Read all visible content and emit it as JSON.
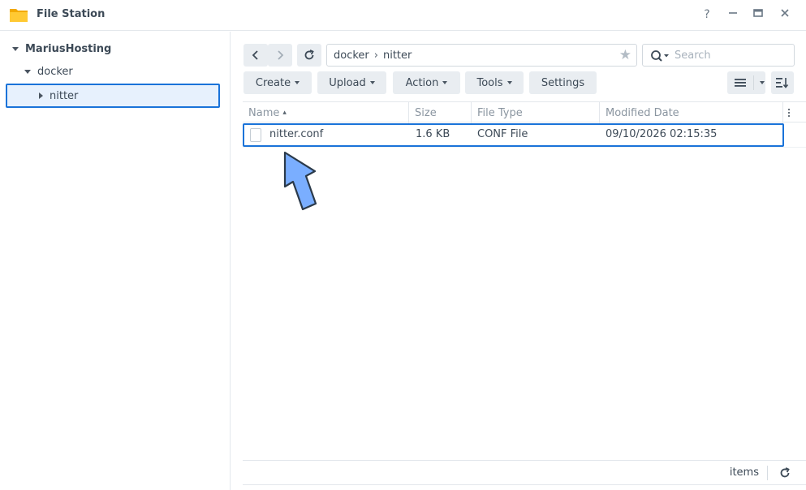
{
  "window": {
    "title": "File Station",
    "controls": {
      "help": "?",
      "minimize": "—",
      "maximize": "□",
      "close": "✕"
    }
  },
  "sidebar": {
    "tree": [
      {
        "label": "MariusHosting",
        "expanded": true
      },
      {
        "label": "docker",
        "expanded": true
      },
      {
        "label": "nitter",
        "expanded": false,
        "selected": true
      }
    ]
  },
  "toolbar": {
    "path": [
      "docker",
      "nitter"
    ],
    "path_separator": "›",
    "search_placeholder": "Search",
    "buttons": {
      "create": "Create",
      "upload": "Upload",
      "action": "Action",
      "tools": "Tools",
      "settings": "Settings"
    }
  },
  "table": {
    "columns": [
      "Name",
      "Size",
      "File Type",
      "Modified Date"
    ],
    "sort_indicator": "▴",
    "rows": [
      {
        "name": "nitter.conf",
        "size": "1.6 KB",
        "type": "CONF File",
        "modified": "09/10/2026 02:15:35"
      }
    ]
  },
  "footer": {
    "count_label": "items"
  },
  "colors": {
    "accent": "#1a73d9",
    "selection_bg": "#e7f1fd",
    "arrow_fill": "#7aaeff",
    "arrow_stroke": "#2b3a4a"
  }
}
